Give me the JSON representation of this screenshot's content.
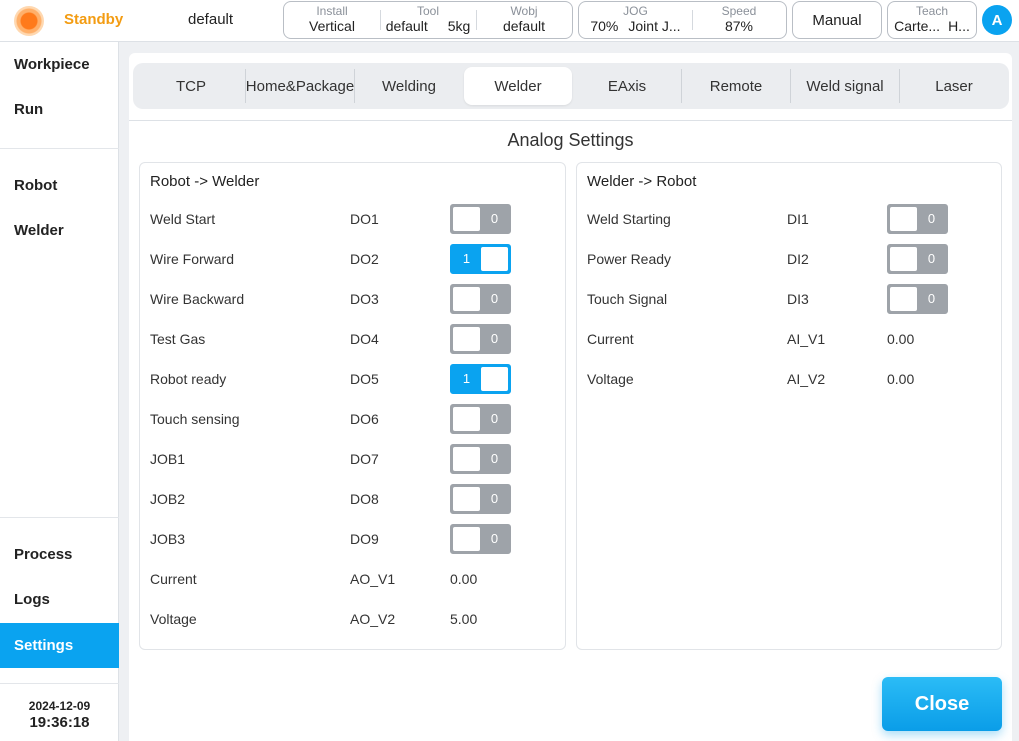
{
  "colors": {
    "accent": "#0aa3f0",
    "status": "#f39c12",
    "toggle_off": "#9ea3a9"
  },
  "header": {
    "status": "Standby",
    "project": "default",
    "install": {
      "caption": "Install",
      "value": "Vertical"
    },
    "tool": {
      "caption": "Tool",
      "value": "default",
      "payload": "5kg"
    },
    "wobj": {
      "caption": "Wobj",
      "value": "default"
    },
    "jog": {
      "caption": "JOG",
      "percent": "70%",
      "mode": "Joint J..."
    },
    "speed": {
      "caption": "Speed",
      "value": "87%"
    },
    "mode_button": "Manual",
    "teach": {
      "caption": "Teach",
      "value1": "Carte...",
      "value2": "H..."
    },
    "avatar": "A"
  },
  "sidebar": {
    "items": [
      {
        "label": "Workpiece"
      },
      {
        "label": "Run"
      },
      {
        "label": "Robot"
      },
      {
        "label": "Welder"
      },
      {
        "label": "Process"
      },
      {
        "label": "Logs"
      },
      {
        "label": "Settings",
        "active": true
      }
    ],
    "date": "2024-12-09",
    "time": "19:36:18"
  },
  "tabs": [
    {
      "label": "TCP"
    },
    {
      "label": "Home&Package"
    },
    {
      "label": "Welding"
    },
    {
      "label": "Welder",
      "active": true
    },
    {
      "label": "EAxis"
    },
    {
      "label": "Remote"
    },
    {
      "label": "Weld signal"
    },
    {
      "label": "Laser"
    }
  ],
  "section_title": "Analog Settings",
  "robot_to_welder": {
    "title": "Robot -> Welder",
    "rows": [
      {
        "label": "Weld Start",
        "code": "DO1",
        "state": "0"
      },
      {
        "label": "Wire Forward",
        "code": "DO2",
        "state": "1"
      },
      {
        "label": "Wire Backward",
        "code": "DO3",
        "state": "0"
      },
      {
        "label": "Test Gas",
        "code": "DO4",
        "state": "0"
      },
      {
        "label": "Robot ready",
        "code": "DO5",
        "state": "1"
      },
      {
        "label": "Touch sensing",
        "code": "DO6",
        "state": "0"
      },
      {
        "label": "JOB1",
        "code": "DO7",
        "state": "0"
      },
      {
        "label": "JOB2",
        "code": "DO8",
        "state": "0"
      },
      {
        "label": "JOB3",
        "code": "DO9",
        "state": "0"
      },
      {
        "label": "Current",
        "code": "AO_V1",
        "value": "0.00"
      },
      {
        "label": "Voltage",
        "code": "AO_V2",
        "value": "5.00"
      }
    ]
  },
  "welder_to_robot": {
    "title": "Welder -> Robot",
    "rows": [
      {
        "label": "Weld Starting",
        "code": "DI1",
        "state": "0"
      },
      {
        "label": "Power Ready",
        "code": "DI2",
        "state": "0"
      },
      {
        "label": "Touch Signal",
        "code": "DI3",
        "state": "0"
      },
      {
        "label": "Current",
        "code": "AI_V1",
        "value": "0.00"
      },
      {
        "label": "Voltage",
        "code": "AI_V2",
        "value": "0.00"
      }
    ]
  },
  "close_button": "Close"
}
